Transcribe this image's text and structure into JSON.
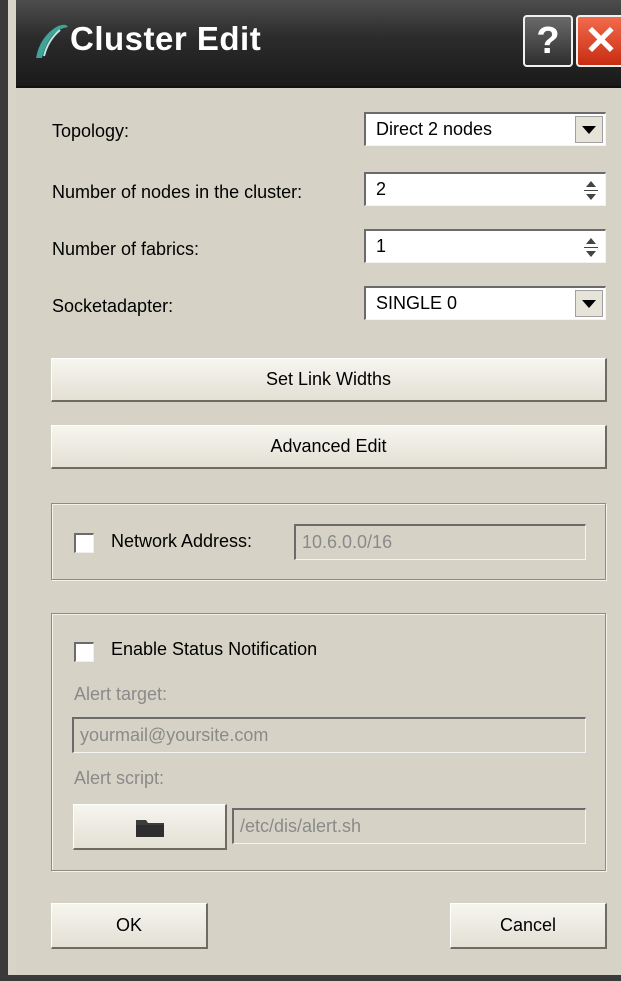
{
  "window": {
    "title": "Cluster Edit",
    "help_symbol": "?",
    "close_symbol": "✕"
  },
  "form": {
    "topology": {
      "label": "Topology:",
      "value": "Direct 2 nodes"
    },
    "nodes": {
      "label": "Number of nodes in the cluster:",
      "value": "2"
    },
    "fabrics": {
      "label": "Number of fabrics:",
      "value": "1"
    },
    "socketadapter": {
      "label": "Socketadapter:",
      "value": "SINGLE 0"
    }
  },
  "buttons": {
    "set_link_widths": "Set Link Widths",
    "advanced_edit": "Advanced Edit",
    "ok": "OK",
    "cancel": "Cancel"
  },
  "network": {
    "checkbox_label": "Network Address:",
    "checked": false,
    "value": "10.6.0.0/16"
  },
  "status_notification": {
    "checkbox_label": "Enable Status Notification",
    "checked": false,
    "alert_target_label": "Alert target:",
    "alert_target_value": "yourmail@yoursite.com",
    "alert_script_label": "Alert script:",
    "alert_script_value": "/etc/dis/alert.sh",
    "browse_icon": "folder-icon"
  },
  "colors": {
    "titlebar": "#2b2b2b",
    "dialog_bg": "#d6d3c6",
    "close_red": "#d9381e",
    "disabled_text": "#8a8a8a"
  }
}
